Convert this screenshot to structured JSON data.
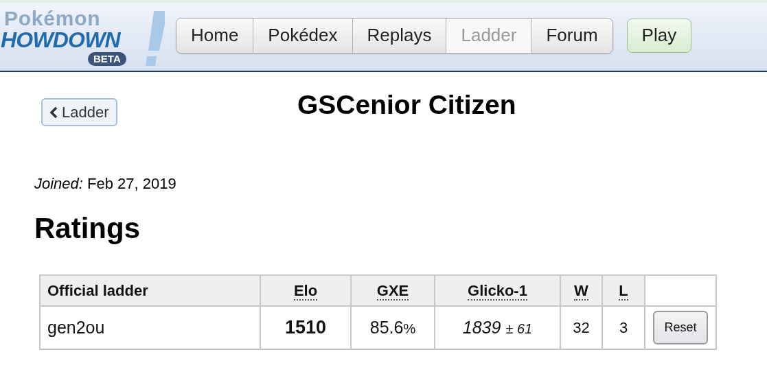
{
  "logo": {
    "top": "Pokémon",
    "main": "HOWDOWN",
    "badge": "BETA"
  },
  "nav": [
    {
      "label": "Home",
      "selected": false
    },
    {
      "label": "Pokédex",
      "selected": false
    },
    {
      "label": "Replays",
      "selected": false
    },
    {
      "label": "Ladder",
      "selected": true
    },
    {
      "label": "Forum",
      "selected": false
    }
  ],
  "play_button": "Play",
  "back_button": "Ladder",
  "title": "GSCenior Citizen",
  "joined": {
    "label": "Joined:",
    "value": "Feb 27, 2019"
  },
  "ratings_heading": "Ratings",
  "table": {
    "columns": [
      "Official ladder",
      "Elo",
      "GXE",
      "Glicko-1",
      "W",
      "L"
    ],
    "rows": [
      {
        "ladder": "gen2ou",
        "elo": "1510",
        "gxe": "85.6",
        "gxe_unit": "%",
        "glicko": "1839",
        "glicko_dev": "± 61",
        "w": "32",
        "l": "3",
        "action": "Reset"
      }
    ]
  }
}
